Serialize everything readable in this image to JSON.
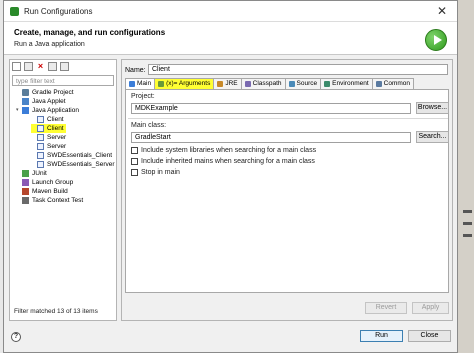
{
  "window": {
    "title": "Run Configurations",
    "close_glyph": "✕"
  },
  "banner": {
    "title": "Create, manage, and run configurations",
    "subtitle": "Run a Java application"
  },
  "left": {
    "filter_placeholder": "type filter text",
    "tree": [
      {
        "label": "Gradle Project",
        "icon": "gradle",
        "level": 0,
        "twisty": ""
      },
      {
        "label": "Java Applet",
        "icon": "applet",
        "level": 0,
        "twisty": ""
      },
      {
        "label": "Java Application",
        "icon": "java",
        "level": 0,
        "twisty": "▾"
      },
      {
        "label": "Client",
        "icon": "cfg",
        "level": 1,
        "twisty": ""
      },
      {
        "label": "Client",
        "icon": "cfg",
        "level": 1,
        "twisty": "",
        "selected": true
      },
      {
        "label": "Server",
        "icon": "cfg",
        "level": 1,
        "twisty": ""
      },
      {
        "label": "Server",
        "icon": "cfg",
        "level": 1,
        "twisty": ""
      },
      {
        "label": "SWDEssentials_Client",
        "icon": "cfg",
        "level": 1,
        "twisty": ""
      },
      {
        "label": "SWDEssentials_Server",
        "icon": "cfg",
        "level": 1,
        "twisty": ""
      },
      {
        "label": "JUnit",
        "icon": "junit",
        "level": 0,
        "twisty": ""
      },
      {
        "label": "Launch Group",
        "icon": "launch",
        "level": 0,
        "twisty": ""
      },
      {
        "label": "Maven Build",
        "icon": "maven",
        "level": 0,
        "twisty": ""
      },
      {
        "label": "Task Context Test",
        "icon": "task",
        "level": 0,
        "twisty": ""
      }
    ],
    "status": "Filter matched 13 of 13 items"
  },
  "right": {
    "name_label": "Name:",
    "name_value": "Client",
    "tabs": [
      {
        "label": "Main",
        "color": "#3b7dd8"
      },
      {
        "label": "(x)= Arguments",
        "color": "#6a9a3a",
        "active": true
      },
      {
        "label": "JRE",
        "color": "#c88a2a"
      },
      {
        "label": "Classpath",
        "color": "#7a6ab0"
      },
      {
        "label": "Source",
        "color": "#4a8ab8"
      },
      {
        "label": "Environment",
        "color": "#3a8a6a"
      },
      {
        "label": "Common",
        "color": "#5a7aa0"
      }
    ],
    "project_label": "Project:",
    "project_value": "MDKExample",
    "browse_label": "Browse...",
    "mainclass_label": "Main class:",
    "mainclass_value": "GradleStart",
    "search_label": "Search...",
    "checkboxes": [
      "Include system libraries when searching for a main class",
      "Include inherited mains when searching for a main class",
      "Stop in main"
    ],
    "revert_label": "Revert",
    "apply_label": "Apply"
  },
  "footer": {
    "run_label": "Run",
    "close_label": "Close",
    "help_glyph": "?"
  }
}
